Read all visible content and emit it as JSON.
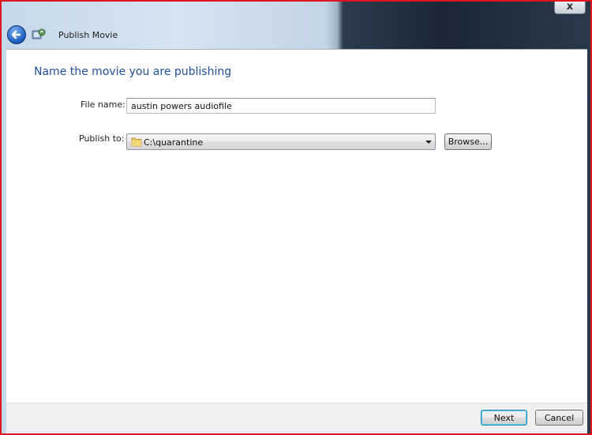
{
  "window": {
    "title": "Publish Movie",
    "close_label": "x"
  },
  "page": {
    "heading": "Name the movie you are publishing"
  },
  "form": {
    "file_name_label": "File name:",
    "file_name_value": "austin powers audiofile",
    "publish_to_label": "Publish to:",
    "publish_to_value": "C:\\quarantine",
    "browse_label": "Browse..."
  },
  "footer": {
    "next_label": "Next",
    "cancel_label": "Cancel"
  },
  "icons": {
    "back": "back-arrow-icon",
    "app": "publish-movie-icon",
    "folder": "folder-icon",
    "dropdown": "chevron-down-icon"
  },
  "colors": {
    "heading": "#1f4f9a",
    "annotation_border": "#e0151b"
  }
}
